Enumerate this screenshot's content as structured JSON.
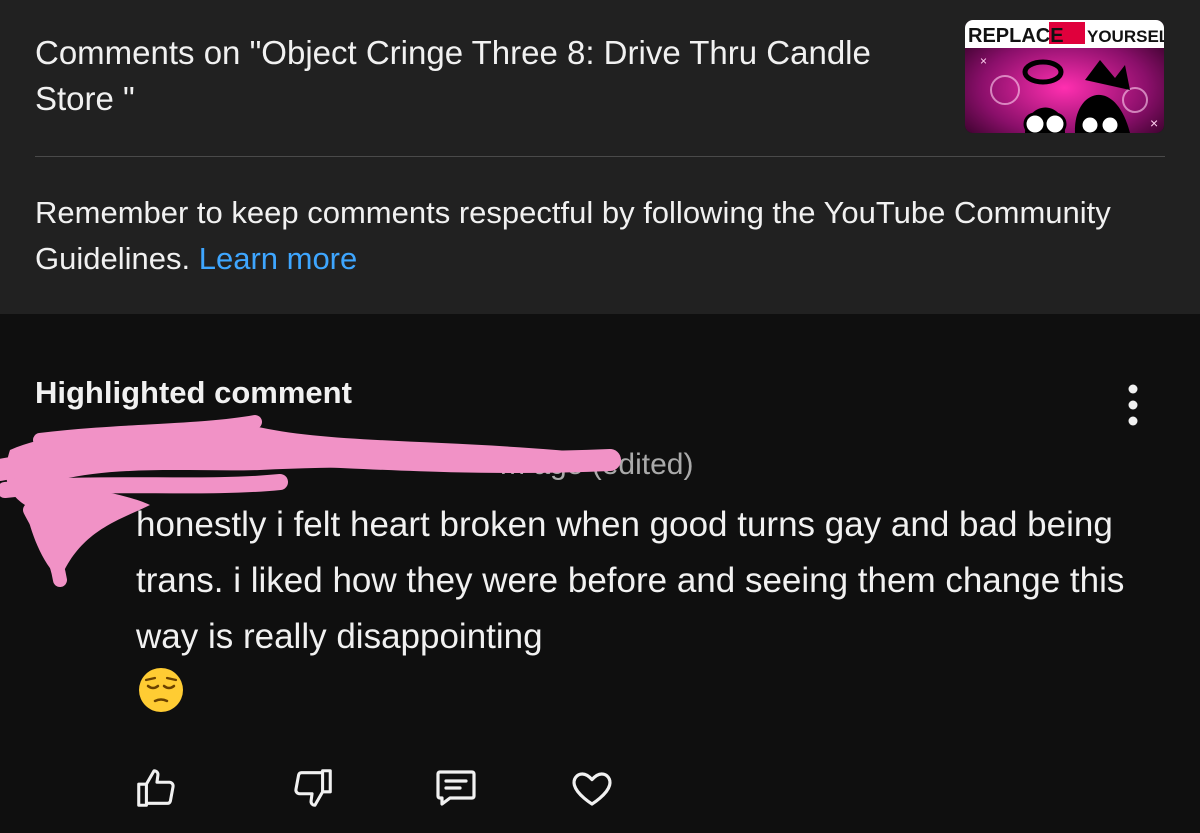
{
  "header": {
    "title": "Comments on \"Object Cringe Three 8: Drive Thru Candle Store \"",
    "thumbnail": {
      "text_left": "REPLACE",
      "text_right": "YOURSELF"
    }
  },
  "guidelines": {
    "text": "Remember to keep comments respectful by following the YouTube Community Guidelines.",
    "link_label": "Learn more"
  },
  "highlighted": {
    "label": "Highlighted comment",
    "meta": "m ago (edited)",
    "body": "honestly i felt heart broken when good turns gay and bad being trans. i liked how they were before and seeing them change this way is really disappointing",
    "emoji": "pensive-face",
    "redaction_color": "#f192c6"
  },
  "actions": {
    "like": "thumbs-up-icon",
    "dislike": "thumbs-down-icon",
    "reply": "comment-icon",
    "heart": "heart-icon"
  },
  "colors": {
    "background": "#0f0f0f",
    "header_background": "#212121",
    "link": "#3ea6ff",
    "meta_text": "#aaaaaa"
  }
}
